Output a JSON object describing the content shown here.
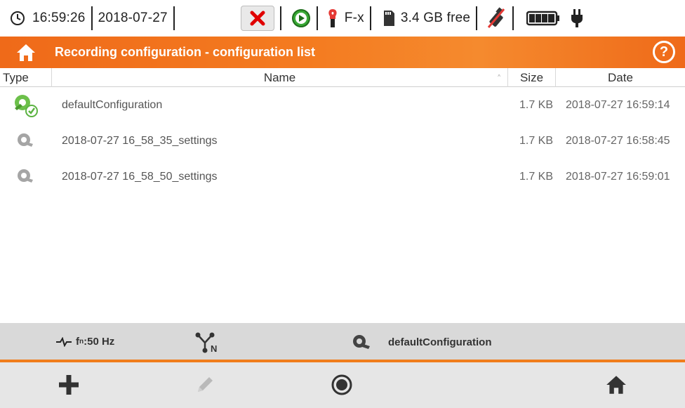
{
  "status_bar": {
    "time": "16:59:26",
    "date": "2018-07-27",
    "clamp_label": "F-x",
    "storage": "3.4 GB free",
    "icons": [
      "clock-icon",
      "stop-icon",
      "play-icon",
      "clamp-icon",
      "sd-card-icon",
      "usb-disabled-icon",
      "battery-icon",
      "plug-icon"
    ]
  },
  "title_bar": {
    "title": "Recording configuration - configuration list",
    "help_label": "?"
  },
  "table": {
    "columns": {
      "type": "Type",
      "name": "Name",
      "size": "Size",
      "date": "Date"
    },
    "sort_indicator": "^",
    "rows": [
      {
        "name": "defaultConfiguration",
        "size": "1.7 KB",
        "date": "2018-07-27 16:59:14",
        "icon": "active-config-icon"
      },
      {
        "name": "2018-07-27 16_58_35_settings",
        "size": "1.7 KB",
        "date": "2018-07-27 16:58:45",
        "icon": "config-icon"
      },
      {
        "name": "2018-07-27 16_58_50_settings",
        "size": "1.7 KB",
        "date": "2018-07-27 16:59:01",
        "icon": "config-icon"
      }
    ]
  },
  "info_bar": {
    "freq_prefix": "f",
    "freq_sub": "n",
    "freq_value": ":50 Hz",
    "network_sub": "N",
    "config_name": "defaultConfiguration"
  },
  "toolbar": {
    "buttons": [
      "add-icon",
      "edit-icon",
      "record-icon",
      "home-icon"
    ]
  },
  "colors": {
    "accent": "#f47b20",
    "active_config": "#5bb341",
    "inactive_icon": "#9e9e9e",
    "stop_red": "#e00000",
    "play_green": "#39a935"
  }
}
